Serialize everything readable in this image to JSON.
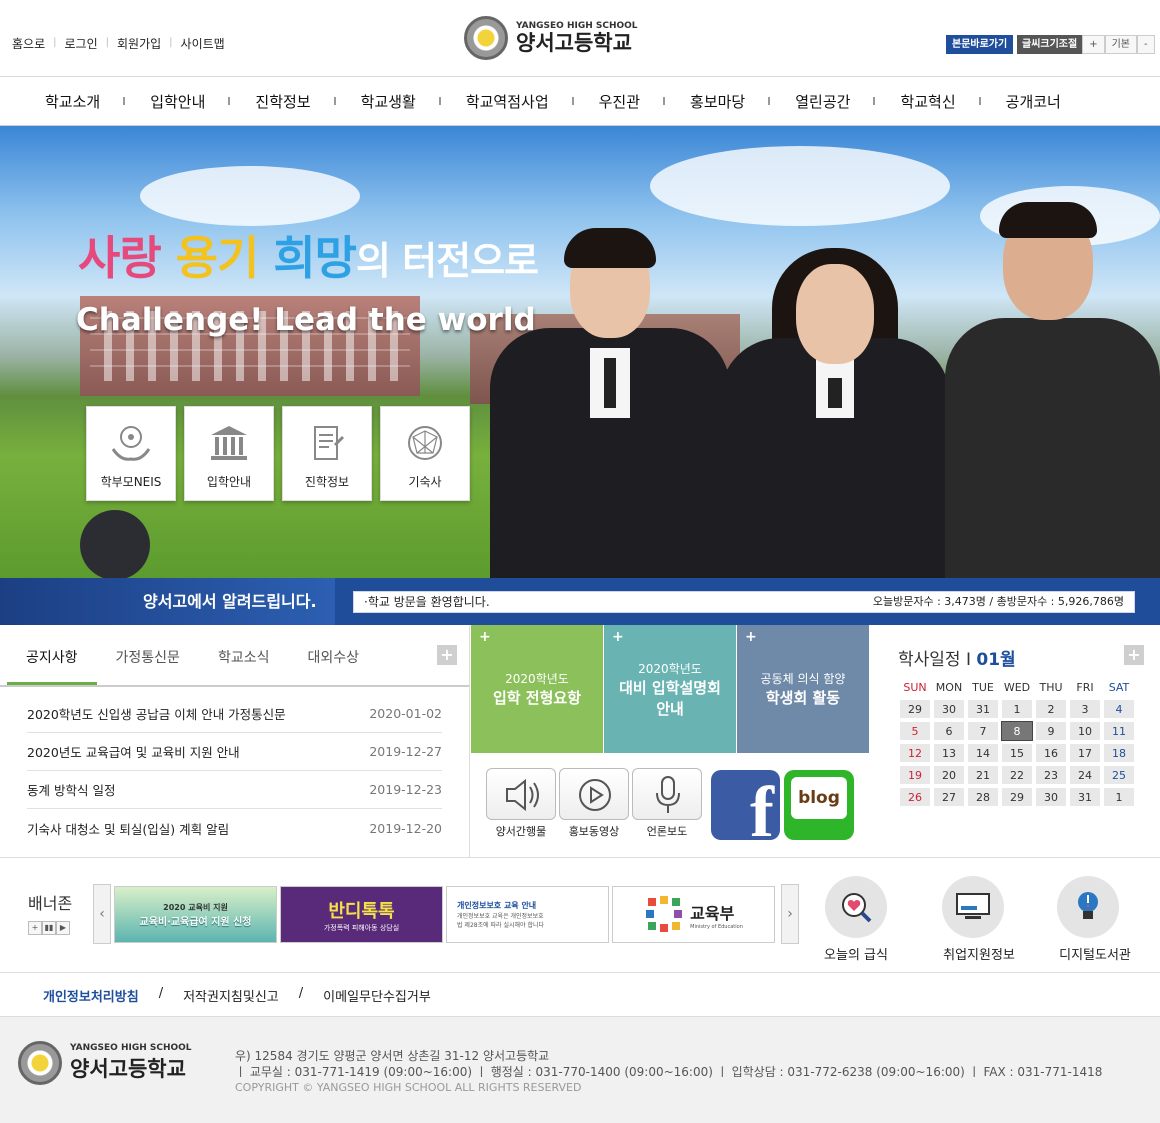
{
  "util_links": [
    "홈으로",
    "로그인",
    "회원가입",
    "사이트맵"
  ],
  "logo": {
    "en": "YANGSEO HIGH SCHOOL",
    "ko": "양서고등학교"
  },
  "skip_label": "본문바로가기",
  "font_ctrl": {
    "label": "글씨크기조절",
    "plus": "+",
    "base": "기본",
    "minus": "-"
  },
  "gnb": [
    "학교소개",
    "입학안내",
    "진학정보",
    "학교생활",
    "학교역점사업",
    "우진관",
    "홍보마당",
    "열린공간",
    "학교혁신",
    "공개코너"
  ],
  "hero": {
    "slogan": {
      "a": "사랑 ",
      "b": "용기 ",
      "c": "희망",
      "d": "의 터전으로"
    },
    "challenge": "Challenge! Lead the world",
    "quick": [
      {
        "label": "학부모NEIS",
        "icon": "hands-network-icon"
      },
      {
        "label": "입학안내",
        "icon": "building-icon"
      },
      {
        "label": "진학정보",
        "icon": "document-icon"
      },
      {
        "label": "기숙사",
        "icon": "network-icon"
      }
    ]
  },
  "notice_bar": {
    "title": "양서고에서 알려드립니다.",
    "message": "·학교 방문을 환영합니다.",
    "visitors": "오늘방문자수 : 3,473명 / 총방문자수 : 5,926,786명"
  },
  "board": {
    "tabs": [
      "공지사항",
      "가정통신문",
      "학교소식",
      "대외수상"
    ],
    "plus": "+",
    "rows": [
      {
        "title": "2020학년도 신입생 공납금 이체 안내 가정통신문",
        "date": "2020-01-02"
      },
      {
        "title": "2020년도 교육급여 및 교육비 지원 안내",
        "date": "2019-12-27"
      },
      {
        "title": "동계 방학식 일정",
        "date": "2019-12-23"
      },
      {
        "title": "기숙사 대청소 및 퇴실(입실) 계획 알림",
        "date": "2019-12-20"
      }
    ]
  },
  "tiles": [
    {
      "t1": "2020학년도",
      "t2": "입학 전형요항",
      "color": "#8cc05b"
    },
    {
      "t1": "2020학년도",
      "t2": "대비 입학설명회 안내",
      "color": "#6ab3b3"
    },
    {
      "t1": "공동체 의식 함양",
      "t2": "학생회 활동",
      "color": "#6f8aa8"
    }
  ],
  "media": [
    "양서간행물",
    "홍보동영상",
    "언론보도"
  ],
  "fb_letter": "f",
  "blog_label": "blog",
  "calendar": {
    "title": "학사일정 I ",
    "month": "01월",
    "plus": "+",
    "days": [
      "SUN",
      "MON",
      "TUE",
      "WED",
      "THU",
      "FRI",
      "SAT"
    ],
    "weeks": [
      [
        "29",
        "30",
        "31",
        "1",
        "2",
        "3",
        "4"
      ],
      [
        "5",
        "6",
        "7",
        "8",
        "9",
        "10",
        "11"
      ],
      [
        "12",
        "13",
        "14",
        "15",
        "16",
        "17",
        "18"
      ],
      [
        "19",
        "20",
        "21",
        "22",
        "23",
        "24",
        "25"
      ],
      [
        "26",
        "27",
        "28",
        "29",
        "30",
        "31",
        "1"
      ]
    ],
    "today": "8",
    "sun_color": "#cc2233",
    "sat_color": "#1e4e9c"
  },
  "banner": {
    "title": "배너존",
    "ctl": [
      "+",
      "▮▮",
      "▶"
    ],
    "prev": "‹",
    "next": "›",
    "items": [
      {
        "text": "교육비·교육급여 지원 신청",
        "sub": "2020 교육비 지원",
        "color": "#3aa6a0"
      },
      {
        "text": "반디톡톡",
        "sub": "가정폭력 피해아동 상담실",
        "color": "#5a2a7a"
      },
      {
        "text": "개인정보보호 교육 안내",
        "sub": "개인정보보호 교육은 개인정보보호법 제28조에 따라 실시해야 합니다",
        "color": "#ffffff"
      },
      {
        "text": "교육부",
        "sub": "Ministry of Education",
        "color": "#ffffff"
      }
    ]
  },
  "circles": [
    {
      "label": "오늘의 급식",
      "icon": "heart-magnifier-icon"
    },
    {
      "label": "취업지원정보",
      "icon": "board-icon"
    },
    {
      "label": "디지털도서관",
      "icon": "lightbulb-icon"
    }
  ],
  "policy": [
    "개인정보처리방침",
    "저작권지침및신고",
    "이메일무단수집거부"
  ],
  "footer": {
    "en": "YANGSEO HIGH SCHOOL",
    "ko": "양서고등학교",
    "addr": "우) 12584 경기도 양평군 양서면 상촌길 31-12 양서고등학교",
    "phones": "ㅣ 교무실 : 031-771-1419 (09:00~16:00)  ㅣ 행정실 : 031-770-1400 (09:00~16:00)  ㅣ 입학상담 : 031-772-6238 (09:00~16:00)  ㅣ FAX : 031-771-1418",
    "copy": "COPYRIGHT © YANGSEO HIGH SCHOOL ALL RIGHTS RESERVED"
  }
}
